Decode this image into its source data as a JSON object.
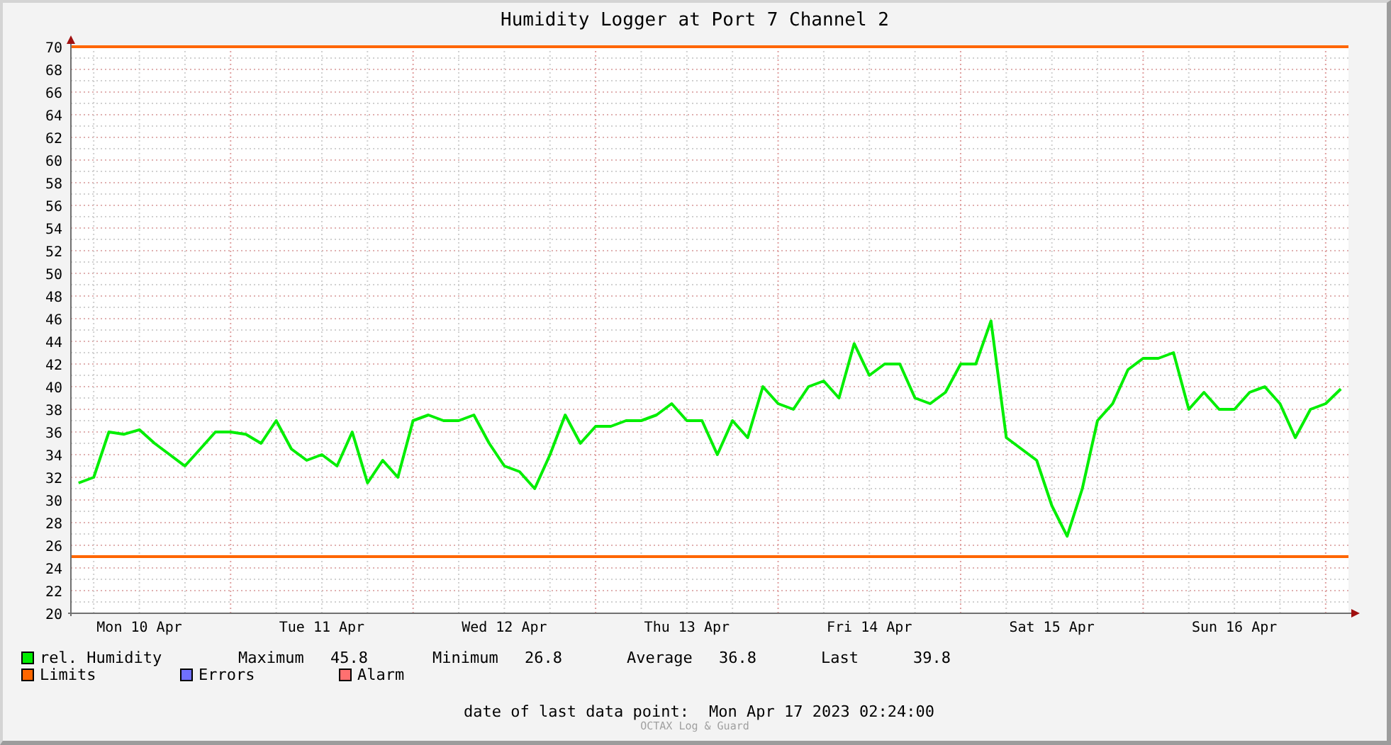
{
  "title": "Humidity Logger at Port 7 Channel 2",
  "chart": {
    "chart_data": {
      "type": "line",
      "ylim": [
        20,
        70
      ],
      "categories": [
        null,
        null,
        null,
        null,
        "Mon 10 Apr",
        null,
        null,
        null,
        null,
        null,
        null,
        null,
        null,
        null,
        null,
        null,
        "Tue 11 Apr",
        null,
        null,
        null,
        null,
        null,
        null,
        null,
        null,
        null,
        null,
        null,
        "Wed 12 Apr",
        null,
        null,
        null,
        null,
        null,
        null,
        null,
        null,
        null,
        null,
        null,
        "Thu 13 Apr",
        null,
        null,
        null,
        null,
        null,
        null,
        null,
        null,
        null,
        null,
        null,
        "Fri 14 Apr",
        null,
        null,
        null,
        null,
        null,
        null,
        null,
        null,
        null,
        null,
        null,
        "Sat 15 Apr",
        null,
        null,
        null,
        null,
        null,
        null,
        null,
        null,
        null,
        null,
        null,
        "Sun 16 Apr",
        null,
        null,
        null,
        null,
        null,
        null,
        null
      ],
      "series": [
        {
          "name": "rel. Humidity",
          "color": "#00ee00",
          "values": [
            31.5,
            32,
            36,
            35.8,
            36.2,
            35,
            34,
            33,
            34.5,
            36,
            36,
            35.8,
            35,
            37,
            34.5,
            33.5,
            34,
            33,
            36,
            31.5,
            33.5,
            32,
            37,
            37.5,
            37,
            37,
            37.5,
            35,
            33,
            32.5,
            31,
            34,
            37.5,
            35,
            36.5,
            36.5,
            37,
            37,
            37.5,
            38.5,
            37,
            37,
            34,
            37,
            35.5,
            40,
            38.5,
            38,
            40,
            40.5,
            39,
            43.8,
            41,
            42,
            42,
            39,
            38.5,
            39.5,
            42,
            42,
            45.8,
            35.5,
            34.5,
            33.5,
            29.5,
            26.8,
            31,
            37,
            38.5,
            41.5,
            42.5,
            42.5,
            43,
            38,
            39.5,
            38,
            38,
            39.5,
            40,
            38.5,
            35.5,
            38,
            38.5,
            39.8
          ]
        }
      ],
      "yticks": [
        20,
        22,
        24,
        26,
        28,
        30,
        32,
        34,
        36,
        38,
        40,
        42,
        44,
        46,
        48,
        50,
        52,
        54,
        56,
        58,
        60,
        62,
        64,
        66,
        68,
        70
      ],
      "grid": true,
      "ref_lines": [
        {
          "axis": "y",
          "value": 70,
          "color": "#ff6600"
        },
        {
          "axis": "y",
          "value": 25,
          "color": "#ff6600"
        }
      ]
    }
  },
  "legend": [
    {
      "label": "Limits",
      "color": "#ff6600"
    },
    {
      "label": "Errors",
      "color": "#7070ff"
    },
    {
      "label": "Alarm",
      "color": "#ff7070"
    }
  ],
  "stats": [
    {
      "label": "Maximum",
      "value": "45.8"
    },
    {
      "label": "Minimum",
      "value": "26.8"
    },
    {
      "label": "Average",
      "value": "36.8"
    },
    {
      "label": "Last",
      "value": "39.8"
    }
  ],
  "footer": {
    "label": "date of last data point:",
    "value": "Mon Apr 17 2023 02:24:00"
  },
  "credit": "OCTAX Log & Guard"
}
